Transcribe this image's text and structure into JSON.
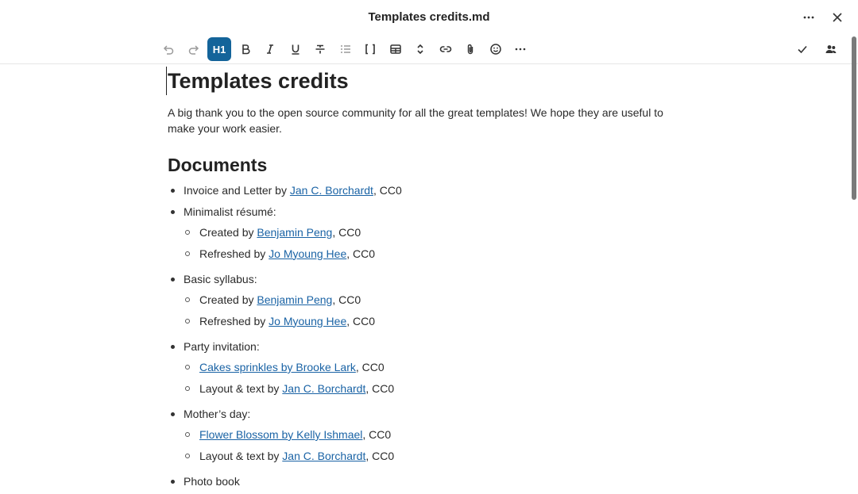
{
  "window": {
    "title": "Templates credits.md"
  },
  "doc": {
    "title": "Templates credits",
    "intro": "A big thank you to the open source community for all the great templates! We hope they are useful to make your work easier.",
    "section_heading": "Documents",
    "items": [
      {
        "pre": "Invoice and Letter by ",
        "link": "Jan C. Borchardt",
        "post": ", CC0"
      },
      {
        "label": "Minimalist résumé:",
        "sub": [
          {
            "pre": "Created by ",
            "link": "Benjamin Peng",
            "post": ", CC0"
          },
          {
            "pre": "Refreshed by ",
            "link": "Jo Myoung Hee",
            "post": ", CC0"
          }
        ]
      },
      {
        "label": "Basic syllabus:",
        "sub": [
          {
            "pre": "Created by ",
            "link": "Benjamin Peng",
            "post": ", CC0"
          },
          {
            "pre": "Refreshed by ",
            "link": "Jo Myoung Hee",
            "post": ", CC0"
          }
        ]
      },
      {
        "label": "Party invitation:",
        "sub": [
          {
            "pre": "",
            "link": "Cakes sprinkles by Brooke Lark",
            "post": ", CC0"
          },
          {
            "pre": "Layout & text by ",
            "link": "Jan C. Borchardt",
            "post": ", CC0"
          }
        ]
      },
      {
        "label": "Mother’s day:",
        "sub": [
          {
            "pre": "",
            "link": "Flower Blossom by Kelly Ishmael",
            "post": ", CC0"
          },
          {
            "pre": "Layout & text by ",
            "link": "Jan C. Borchardt",
            "post": ", CC0"
          }
        ]
      },
      {
        "label": "Photo book"
      }
    ]
  },
  "toolbar": {
    "heading_label": "H1"
  },
  "colors": {
    "accent": "#14649a",
    "link": "#1a63a5"
  }
}
